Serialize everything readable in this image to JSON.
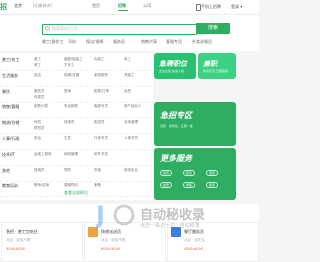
{
  "topbar": {
    "logo": "招",
    "location": "北京",
    "location_sub": "[切换城市]",
    "tabs": [
      "首页",
      "招聘",
      "公司"
    ],
    "active_tab_index": 1,
    "phone_label": "手机上招聘",
    "account_label": "登录 ▾"
  },
  "search": {
    "placeholder": "搜索职位/公司",
    "button_label": "搜索",
    "hot_words": [
      "普工/操作工",
      "司机",
      "保洁/保姆",
      "服务员",
      "销售代表",
      "客服专员",
      "外卖送餐员",
      "快递员"
    ]
  },
  "categories": [
    {
      "name": "普工/技工",
      "items": [
        "普工",
        "装配/组装工",
        "包装工",
        "电工",
        "焊工",
        "叉车工"
      ]
    },
    {
      "name": "生活服务",
      "items": [
        "保洁",
        "保姆/月嫂",
        "家政服务",
        "洗碗工"
      ]
    },
    {
      "name": "餐饮",
      "items": [
        "服务员",
        "厨师",
        "配菜/打荷",
        "后厨",
        "传菜员"
      ]
    },
    {
      "name": "销售/客服",
      "items": [
        "销售代表",
        "电话销售",
        "客服专员",
        "房产经纪人"
      ]
    },
    {
      "name": "物流/仓储",
      "items": [
        "司机",
        "快递员",
        "配送员",
        "仓库管理",
        "理货员"
      ]
    },
    {
      "name": "人事/行政",
      "items": [
        "前台",
        "文员",
        "行政专员",
        "人事专员"
      ]
    },
    {
      "name": "技术/IT",
      "items": [
        "运维工程师",
        "网络管理",
        "软件开发"
      ]
    },
    {
      "name": "其他",
      "items": [
        "促销员",
        "导购",
        "安保",
        "保安队长"
      ]
    },
    {
      "name": "教育培训",
      "items": [
        "教师/讲师",
        "课程顾问",
        "家教"
      ]
    }
  ],
  "view_all": "查看全部职位",
  "promos": [
    {
      "title": "急聘职位",
      "subtitle": "企业急招 快速入职",
      "button": "立即查看",
      "color": "#29c072"
    },
    {
      "title": "兼职",
      "subtitle": "时间灵活 日结薪资",
      "button": "GO",
      "color": "#3dd184"
    },
    {
      "title": "急招专区",
      "subtitle": "高薪 · 包吃住 · 五险一金",
      "button": "",
      "color": "#2fae63"
    },
    {
      "title": "更多服务",
      "subtitle": "招聘 求职 培训",
      "buttons": [
        "简历",
        "职位",
        "培训",
        "招聘",
        "求职",
        "更多"
      ],
      "color": "#2fae63"
    }
  ],
  "jobs": [
    {
      "title": "急招 · 普工包吃住",
      "meta": "北京 · 经验不限",
      "tag": "5000-8000"
    },
    {
      "title": "快递派送员",
      "meta": "北京 · 经验不限",
      "tag": "6000-9000"
    },
    {
      "title": "餐厅服务员",
      "meta": "北京 · 包吃住",
      "tag": "4000-6000"
    }
  ],
  "watermark": {
    "brand": "自动秘收录",
    "slogan": "点击一来访一次 · 自动收录"
  }
}
